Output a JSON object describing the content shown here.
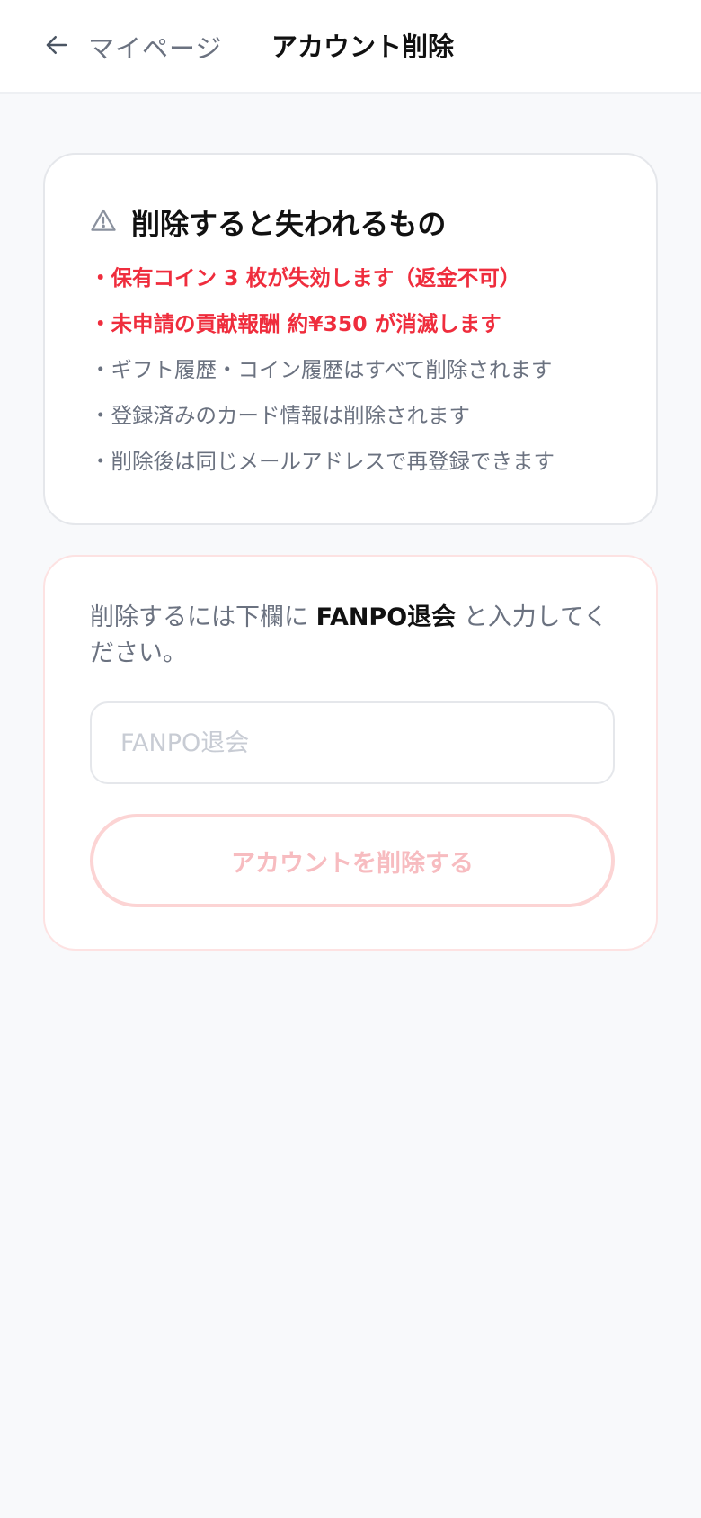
{
  "header": {
    "back_label": "マイページ",
    "title": "アカウント削除"
  },
  "warning_card": {
    "icon": "warning-triangle-icon",
    "title": "削除すると失われるもの",
    "items": [
      {
        "text": "・保有コイン 3 枚が失効します（返金不可）",
        "highlight": true
      },
      {
        "text": "・未申請の貢献報酬 約¥350 が消滅します",
        "highlight": true
      },
      {
        "text": "・ギフト履歴・コイン履歴はすべて削除されます",
        "highlight": false
      },
      {
        "text": "・登録済みのカード情報は削除されます",
        "highlight": false
      },
      {
        "text": "・削除後は同じメールアドレスで再登録できます",
        "highlight": false
      }
    ]
  },
  "confirm_card": {
    "instruction_before": "削除するには下欄に ",
    "confirm_keyword": "FANPO退会",
    "instruction_after": " と入力してください。",
    "input_value": "",
    "input_placeholder": "FANPO退会",
    "delete_button_label": "アカウントを削除する"
  },
  "colors": {
    "danger": "#ef2d3d",
    "muted": "#6b7280",
    "disabled_button_text": "#f7bcc0",
    "disabled_button_border": "#fcd4d4",
    "background": "#f8f9fb"
  }
}
